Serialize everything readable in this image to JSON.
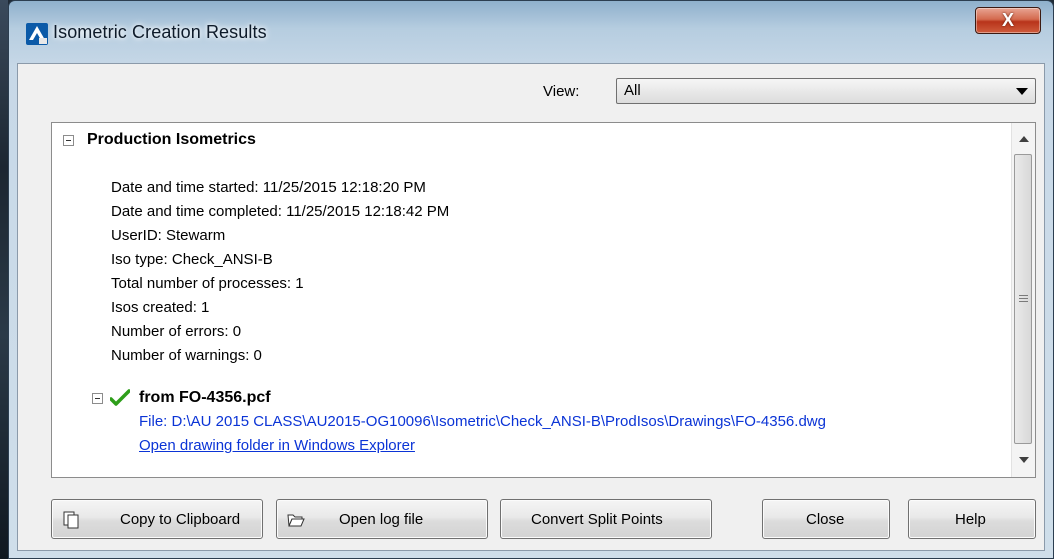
{
  "window": {
    "title": "Isometric Creation Results",
    "close_label": "X"
  },
  "view": {
    "label": "View:",
    "selected": "All"
  },
  "results": {
    "section_title": "Production Isometrics",
    "details": [
      "Date and time started: 11/25/2015 12:18:20 PM",
      "Date and time completed: 11/25/2015 12:18:42 PM",
      "UserID: Stewarm",
      "Iso type: Check_ANSI-B",
      "Total number of processes: 1",
      "Isos created: 1",
      "Number of errors: 0",
      "Number of warnings: 0"
    ],
    "file_item": {
      "title": "from FO-4356.pcf",
      "path": "File: D:\\AU 2015 CLASS\\AU2015-OG10096\\Isometric\\Check_ANSI-B\\ProdIsos\\Drawings\\FO-4356.dwg",
      "link": "Open drawing folder in Windows Explorer",
      "status": "success"
    }
  },
  "buttons": {
    "copy": "Copy to Clipboard",
    "open_log": "Open log file",
    "convert": "Convert Split Points",
    "close": "Close",
    "help": "Help"
  },
  "colors": {
    "link": "#0b34d6",
    "check": "#2e9e1a",
    "close_button": "#c1432a"
  },
  "icons": {
    "app": "autocad-plant3d-icon",
    "copy": "copy-icon",
    "open_log": "folder-open-icon",
    "status": "checkmark-icon"
  }
}
